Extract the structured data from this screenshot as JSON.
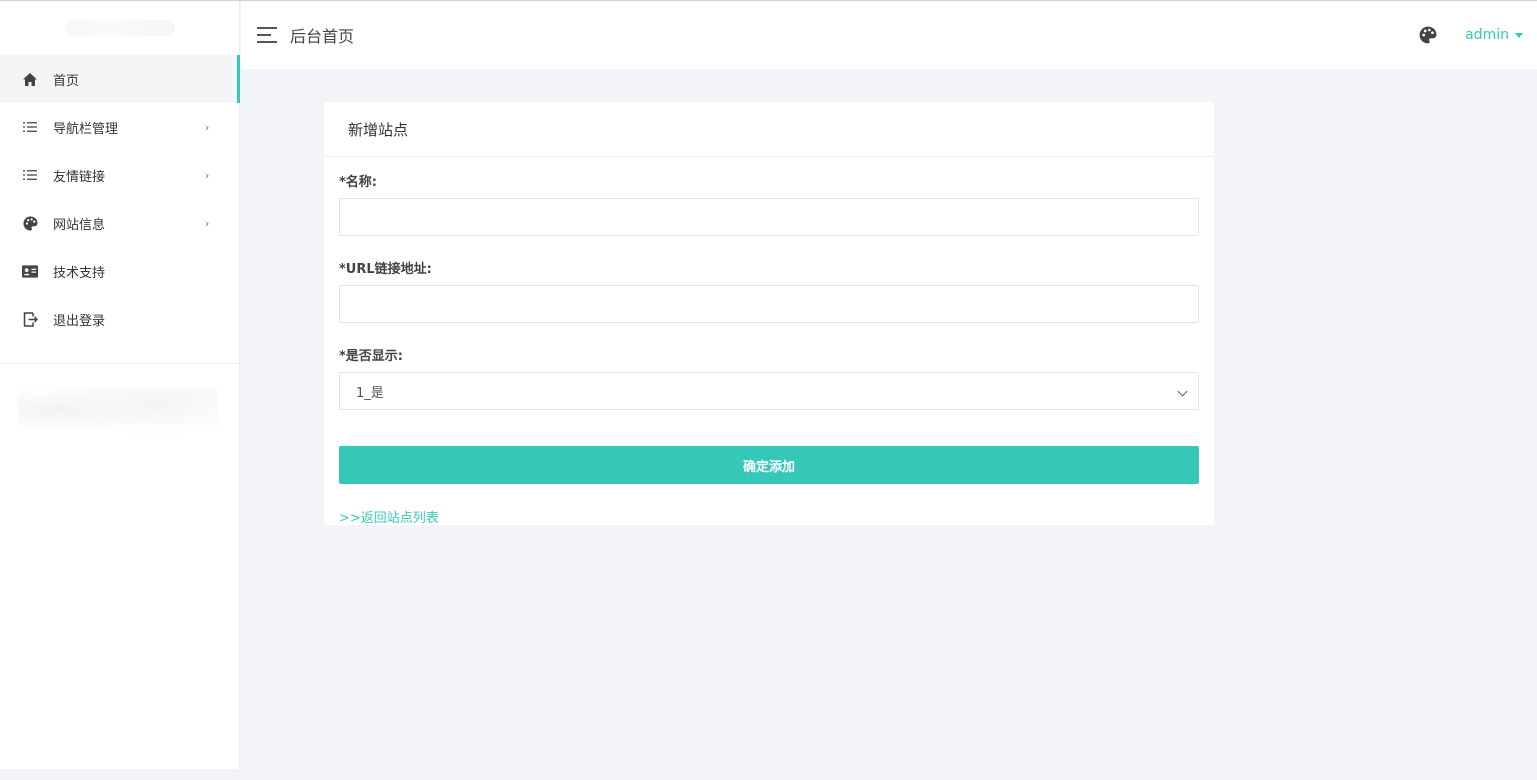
{
  "colors": {
    "accent": "#35c8b8",
    "page_bg": "#f3f4f8",
    "card_bg": "#ffffff"
  },
  "header": {
    "title": "后台首页",
    "user": "admin",
    "theme_icon": "palette-icon",
    "menu_icon": "hamburger-icon"
  },
  "sidebar": {
    "items": [
      {
        "label": "首页",
        "icon": "home-icon",
        "has_submenu": false,
        "active": true
      },
      {
        "label": "导航栏管理",
        "icon": "list-icon",
        "has_submenu": true,
        "active": false
      },
      {
        "label": "友情链接",
        "icon": "list-icon",
        "has_submenu": true,
        "active": false
      },
      {
        "label": "网站信息",
        "icon": "palette-icon",
        "has_submenu": true,
        "active": false
      },
      {
        "label": "技术支持",
        "icon": "id-card-icon",
        "has_submenu": false,
        "active": false
      },
      {
        "label": "退出登录",
        "icon": "logout-icon",
        "has_submenu": false,
        "active": false
      }
    ]
  },
  "form": {
    "title": "新增站点",
    "name_label": "*名称:",
    "name_value": "",
    "url_label": "*URL链接地址:",
    "url_value": "",
    "display_label": "*是否显示:",
    "display_selected": "1_是",
    "submit_label": "确定添加",
    "back_link": ">>返回站点列表"
  }
}
